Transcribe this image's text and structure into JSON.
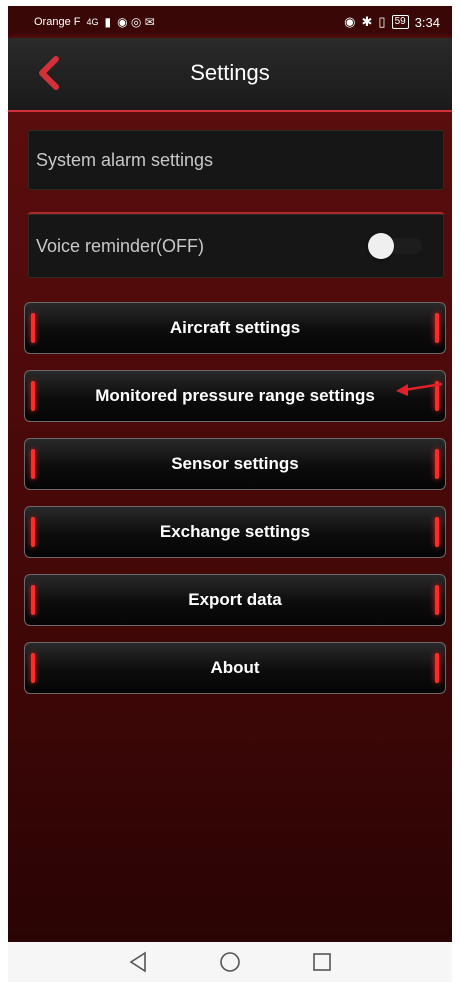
{
  "status_bar": {
    "carrier": "Orange F",
    "network": "4G",
    "battery": "59",
    "time": "3:34"
  },
  "header": {
    "title": "Settings",
    "back_icon": "chevron-left-icon"
  },
  "settings": {
    "system_alarm_label": "System alarm settings",
    "voice_reminder_label": "Voice reminder(OFF)",
    "voice_reminder_on": false
  },
  "menu": [
    {
      "label": "Aircraft settings"
    },
    {
      "label": "Monitored pressure range settings"
    },
    {
      "label": "Sensor settings"
    },
    {
      "label": "Exchange settings"
    },
    {
      "label": "Export data"
    },
    {
      "label": "About"
    }
  ],
  "colors": {
    "accent": "#d3303a",
    "background": "#4a0909",
    "annotation_arrow": "#e0202a"
  },
  "nav": {
    "back": "triangle-back-icon",
    "home": "circle-home-icon",
    "recents": "square-recents-icon"
  }
}
